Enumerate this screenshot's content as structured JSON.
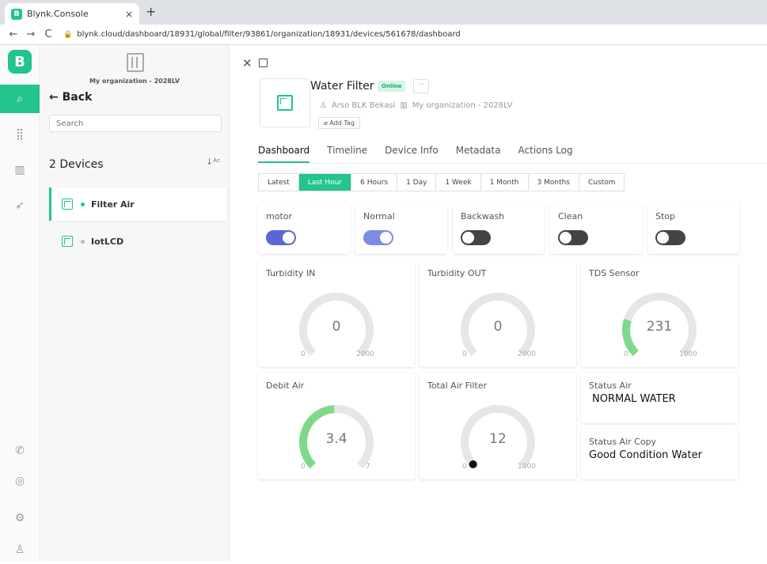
{
  "browser": {
    "tab_title": "Blynk.Console",
    "tab_close": "×",
    "new_tab": "+",
    "url": "blynk.cloud/dashboard/18931/global/filter/93861/organization/18931/devices/561678/dashboard",
    "favicon_letter": "B"
  },
  "rail": {
    "logo_letter": "B",
    "items": [
      "search-icon",
      "grid-icon",
      "building-icon",
      "send-icon",
      "megaphone-icon",
      "help-icon",
      "settings-icon",
      "user-icon"
    ]
  },
  "sidebar": {
    "org_name": "My organization - 2028LV",
    "back_label": "← Back",
    "search_placeholder": "Search",
    "device_count": "2 Devices",
    "sort_icon": "↓ᴬᶻ",
    "devices": [
      {
        "name": "Filter Air",
        "online": true
      },
      {
        "name": "IotLCD",
        "online": false
      }
    ]
  },
  "device": {
    "name": "Water Filter",
    "status": "Online",
    "more": "···",
    "owner": "Arso BLK Bekasi",
    "org": "My organization - 2028LV",
    "add_tag": "Add Tag"
  },
  "tabs": [
    "Dashboard",
    "Timeline",
    "Device Info",
    "Metadata",
    "Actions Log"
  ],
  "ranges": [
    "Latest",
    "Last Hour",
    "6 Hours",
    "1 Day",
    "1 Week",
    "1 Month",
    "3 Months",
    "Custom"
  ],
  "switches": [
    {
      "label": "motor",
      "on": true
    },
    {
      "label": "Normal",
      "on": true
    },
    {
      "label": "Backwash",
      "on": false
    },
    {
      "label": "Clean",
      "on": false
    },
    {
      "label": "Stop",
      "on": false
    }
  ],
  "gauges": [
    {
      "label": "Turbidity IN",
      "value": "0",
      "min": "0",
      "max": "2000",
      "fraction": 0
    },
    {
      "label": "Turbidity OUT",
      "value": "0",
      "min": "0",
      "max": "2000",
      "fraction": 0
    },
    {
      "label": "TDS Sensor",
      "value": "231",
      "min": "0",
      "max": "1000",
      "fraction": 0.231
    },
    {
      "label": "Debit Air",
      "value": "3.4",
      "min": "0",
      "max": "7",
      "fraction": 0.486
    },
    {
      "label": "Total Air Filter",
      "value": "12",
      "min": "0",
      "max": "1000",
      "fraction": 0.012
    }
  ],
  "labels": [
    {
      "label": "Status Air",
      "value": "NORMAL WATER"
    },
    {
      "label": "Status Air Copy",
      "value": "Good Condition Water"
    }
  ],
  "colors": {
    "accent": "#23c48e",
    "switch_on": "#5b66d6",
    "gauge_track": "#e6e6e6",
    "gauge_fill": "#7ed98a"
  }
}
